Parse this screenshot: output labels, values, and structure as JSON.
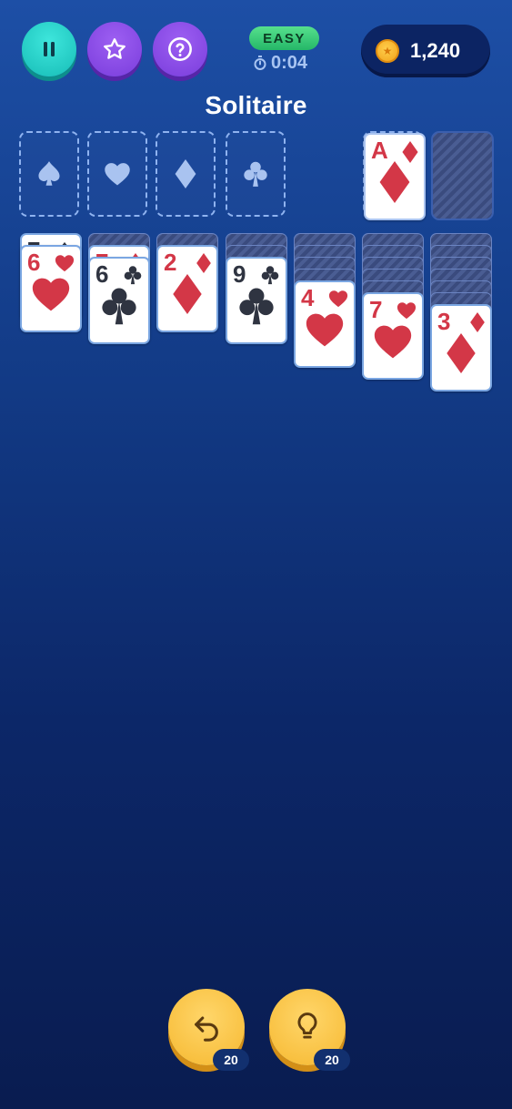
{
  "header": {
    "difficulty": "EASY",
    "timer": "0:04",
    "coins": "1,240",
    "title": "Solitaire"
  },
  "buttons": {
    "pause_icon": "pause-icon",
    "favorite_icon": "star-icon",
    "help_icon": "question-icon"
  },
  "foundations": [
    {
      "suit": "spades"
    },
    {
      "suit": "hearts"
    },
    {
      "suit": "diamonds"
    },
    {
      "suit": "clubs"
    }
  ],
  "waste": {
    "rank": "A",
    "suit": "diamonds"
  },
  "tableau": [
    {
      "hidden": 0,
      "cards": [
        {
          "rank": "7",
          "suit": "spades"
        },
        {
          "rank": "6",
          "suit": "hearts"
        }
      ]
    },
    {
      "hidden": 1,
      "cards": [
        {
          "rank": "7",
          "suit": "diamonds"
        },
        {
          "rank": "6",
          "suit": "clubs"
        }
      ]
    },
    {
      "hidden": 1,
      "cards": [
        {
          "rank": "2",
          "suit": "diamonds"
        }
      ]
    },
    {
      "hidden": 2,
      "cards": [
        {
          "rank": "9",
          "suit": "clubs"
        }
      ]
    },
    {
      "hidden": 4,
      "cards": [
        {
          "rank": "4",
          "suit": "hearts"
        }
      ]
    },
    {
      "hidden": 5,
      "cards": [
        {
          "rank": "7",
          "suit": "hearts"
        }
      ]
    },
    {
      "hidden": 6,
      "cards": [
        {
          "rank": "3",
          "suit": "diamonds"
        }
      ]
    }
  ],
  "actions": {
    "undo_count": "20",
    "hint_count": "20"
  },
  "colors": {
    "red_suit": "#d33747",
    "black_suit": "#2f3441",
    "accent_teal": "#2fd6cf",
    "accent_purple": "#8a4ce8",
    "gold": "#f6b830"
  }
}
